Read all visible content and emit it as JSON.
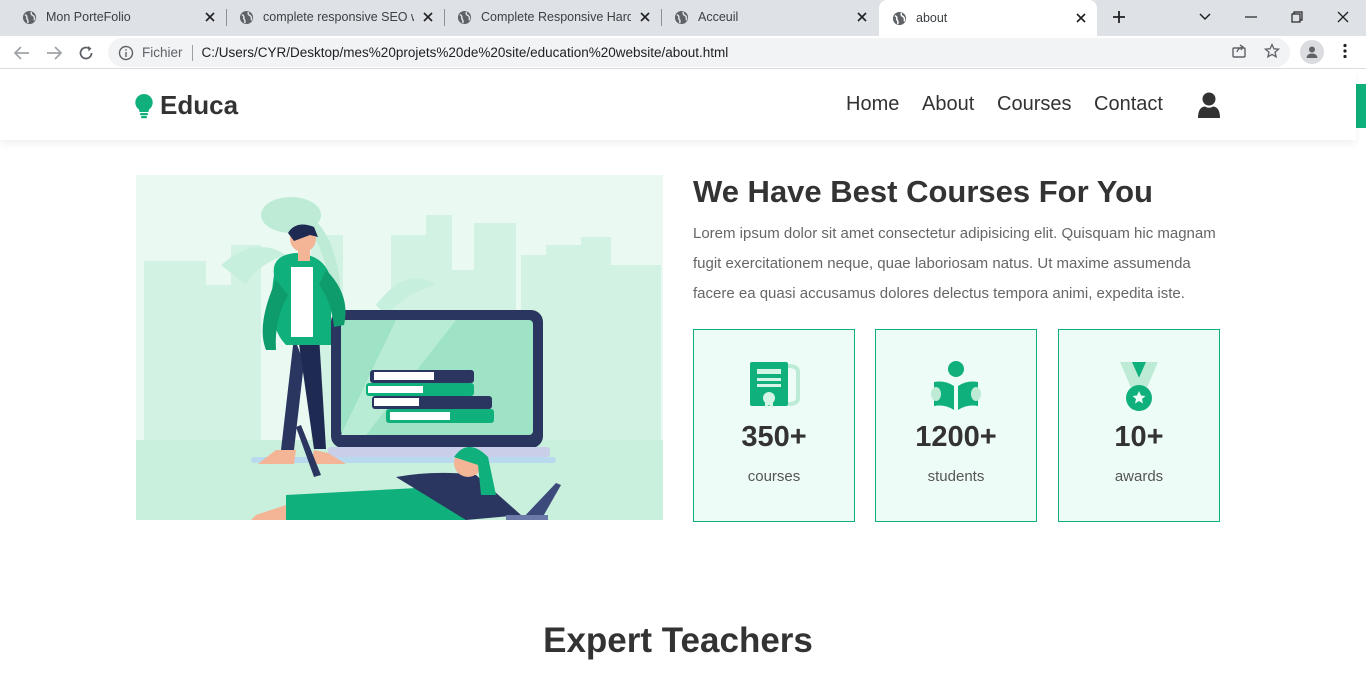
{
  "browser": {
    "tabs": [
      {
        "title": "Mon PorteFolio",
        "active": false
      },
      {
        "title": "complete responsive SEO we",
        "active": false
      },
      {
        "title": "Complete Responsive Hardw",
        "active": false
      },
      {
        "title": "Acceuil",
        "active": false
      },
      {
        "title": "about",
        "active": true
      }
    ],
    "address": {
      "scheme_label": "Fichier",
      "url": "C:/Users/CYR/Desktop/mes%20projets%20de%20site/education%20website/about.html"
    }
  },
  "header": {
    "logo_text": "Educa",
    "nav": [
      "Home",
      "About",
      "Courses",
      "Contact"
    ]
  },
  "about": {
    "heading": "We Have Best Courses For You",
    "paragraph": "Lorem ipsum dolor sit amet consectetur adipisicing elit. Quisquam hic magnam fugit exercitationem neque, quae laboriosam natus. Ut maxime assumenda facere ea quasi accusamus dolores delectus tempora animi, expedita iste.",
    "stats": [
      {
        "icon": "certificate-icon",
        "number": "350+",
        "label": "courses"
      },
      {
        "icon": "reader-icon",
        "number": "1200+",
        "label": "students"
      },
      {
        "icon": "medal-icon",
        "number": "10+",
        "label": "awards"
      }
    ]
  },
  "teachers": {
    "title": "Expert Teachers"
  },
  "colors": {
    "accent": "#10b07c",
    "stat_bg": "#eefcf7",
    "text": "#333333",
    "muted": "#666666",
    "tabstrip": "#dee1e6"
  }
}
